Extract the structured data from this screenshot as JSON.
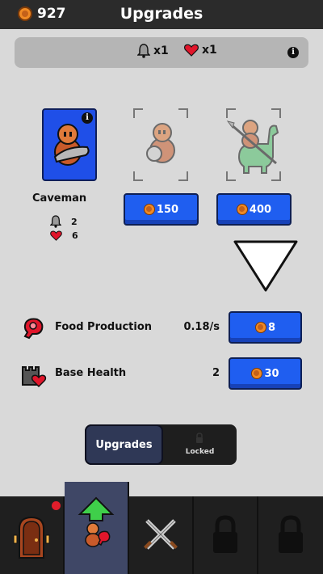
{
  "header": {
    "currency_amount": "927",
    "title": "Upgrades"
  },
  "modifiers": {
    "attack_multiplier": "x1",
    "health_multiplier": "x1",
    "info_glyph": "i"
  },
  "units": {
    "selected": {
      "name": "Caveman",
      "attack": "2",
      "health": "6",
      "card_color": "#1f4fe8"
    },
    "unlock_prices": [
      "150",
      "400"
    ]
  },
  "upgrades": [
    {
      "label": "Food Production",
      "value": "0.18/s",
      "cost": "8",
      "icon": "meat-icon"
    },
    {
      "label": "Base Health",
      "value": "2",
      "cost": "30",
      "icon": "castle-heart-icon"
    }
  ],
  "tabs": {
    "upgrades_label": "Upgrades",
    "locked_label": "Locked"
  },
  "bottom_nav": [
    {
      "icon": "door-icon",
      "notification": true
    },
    {
      "icon": "upgrade-arrow-icon",
      "active": true
    },
    {
      "icon": "crossed-swords-icon"
    },
    {
      "icon": "padlock-icon"
    },
    {
      "icon": "padlock-icon"
    }
  ],
  "colors": {
    "accent_blue": "#1f5ef0",
    "coin_orange": "#f08a24",
    "notification_red": "#e11d2b"
  }
}
